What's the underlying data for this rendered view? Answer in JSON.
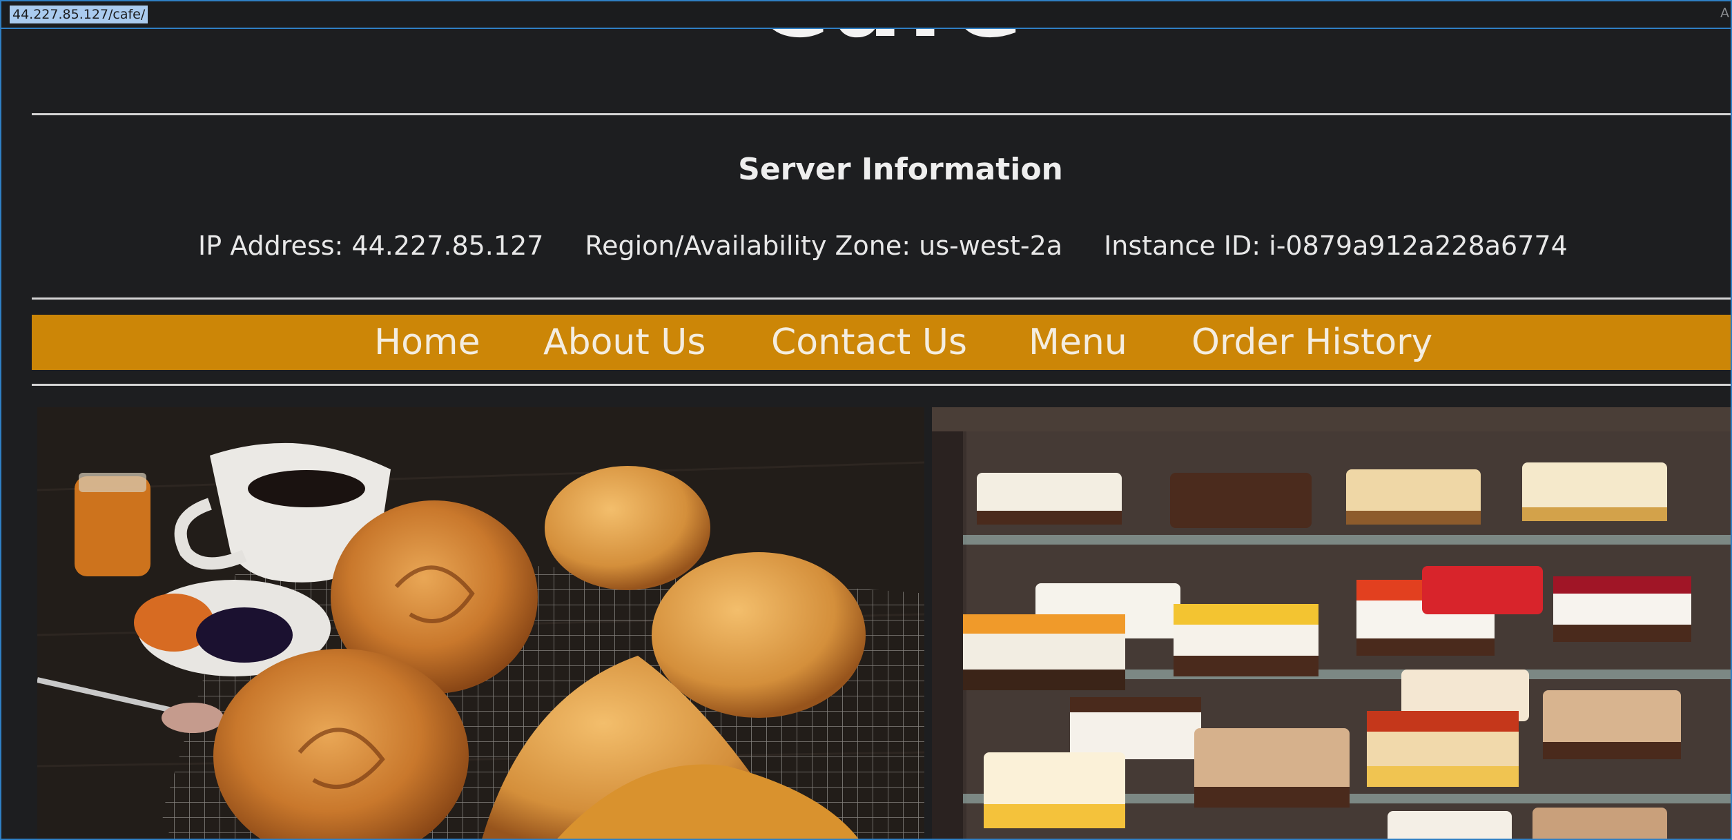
{
  "browser": {
    "url": "44.227.85.127/cafe/",
    "corner_glyph": "A"
  },
  "header": {
    "logo_text": "Cafe"
  },
  "server_info": {
    "title": "Server Information",
    "ip": "IP Address: 44.227.85.127",
    "region": "Region/Availability Zone: us-west-2a",
    "instance": "Instance ID: i-0879a912a228a6774"
  },
  "nav": {
    "items": [
      {
        "label": "Home"
      },
      {
        "label": "About Us"
      },
      {
        "label": "Contact Us"
      },
      {
        "label": "Menu"
      },
      {
        "label": "Order History"
      }
    ]
  },
  "images": {
    "left": "pastries-photo",
    "right": "cake-display-photo"
  },
  "colors": {
    "background": "#1d1e20",
    "nav_bar": "#cc8607",
    "nav_text": "#f4ede0",
    "rule": "#d5d5d5",
    "selection": "#aacbef"
  }
}
